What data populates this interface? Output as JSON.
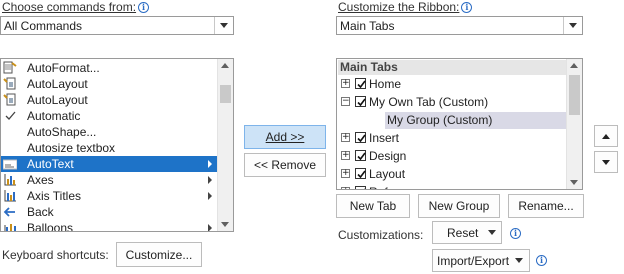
{
  "left_panel": {
    "choose_label": "Choose commands from:",
    "commands_combo_value": "All Commands",
    "commands": [
      {
        "label": "AutoFormat...",
        "icon": "autoformat-icon",
        "has_submenu": false
      },
      {
        "label": "AutoLayout",
        "icon": "autolayout-icon",
        "has_submenu": false
      },
      {
        "label": "AutoLayout",
        "icon": "autolayout-icon",
        "has_submenu": false
      },
      {
        "label": "Automatic",
        "icon": "checkmark-icon",
        "has_submenu": false
      },
      {
        "label": "AutoShape...",
        "icon": "",
        "has_submenu": false
      },
      {
        "label": "Autosize textbox",
        "icon": "",
        "has_submenu": false
      },
      {
        "label": "AutoText",
        "icon": "autotext-icon",
        "has_submenu": true,
        "selected": true
      },
      {
        "label": "Axes",
        "icon": "axes-icon",
        "has_submenu": true
      },
      {
        "label": "Axis Titles",
        "icon": "axis-titles-icon",
        "has_submenu": true
      },
      {
        "label": "Back",
        "icon": "back-arrow-icon",
        "has_submenu": false
      },
      {
        "label": "Balloons",
        "icon": "balloons-icon",
        "has_submenu": true
      }
    ],
    "keyboard_label": "Keyboard shortcuts:",
    "customize_button": "Customize..."
  },
  "middle": {
    "add_button": "Add >>",
    "remove_button": "<< Remove"
  },
  "right_panel": {
    "customize_label": "Customize the Ribbon:",
    "ribbon_combo_value": "Main Tabs",
    "tree_header": "Main Tabs",
    "tree": [
      {
        "label": "Home",
        "expander": "+",
        "checked": true,
        "level": 0
      },
      {
        "label": "My Own Tab (Custom)",
        "expander": "−",
        "checked": true,
        "level": 0
      },
      {
        "label": "My Group (Custom)",
        "expander": "",
        "checked": null,
        "level": 1,
        "selected": true
      },
      {
        "label": "Insert",
        "expander": "+",
        "checked": true,
        "level": 0
      },
      {
        "label": "Design",
        "expander": "+",
        "checked": true,
        "level": 0
      },
      {
        "label": "Layout",
        "expander": "+",
        "checked": true,
        "level": 0
      },
      {
        "label": "Refe",
        "expander": "+",
        "checked": true,
        "level": 0,
        "cut_off": true
      }
    ],
    "new_tab_button": "New Tab",
    "new_group_button": "New Group",
    "rename_button": "Rename...",
    "customizations_label": "Customizations:",
    "reset_button": "Reset",
    "import_export_button": "Import/Export"
  },
  "accent_colors": {
    "selection_blue": "#1e73c8",
    "selection_gray": "#d9d9e6",
    "info_blue": "#2b6cc4"
  }
}
